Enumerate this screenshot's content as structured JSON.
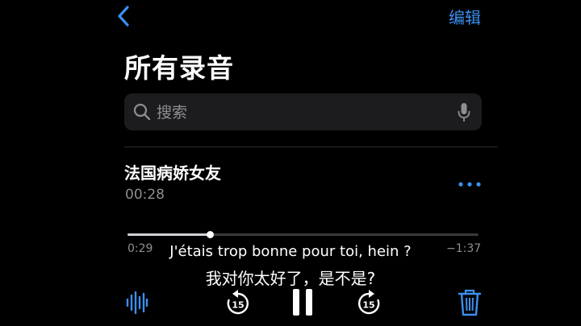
{
  "header": {
    "edit_label": "编辑"
  },
  "page": {
    "title": "所有录音"
  },
  "search": {
    "placeholder": "搜索"
  },
  "recording": {
    "title": "法国病娇女友",
    "duration": "00:28",
    "elapsed": "0:29",
    "remaining": "−1:37",
    "progress": 0.235
  },
  "subtitles": {
    "french": "J'étais trop bonne pour toi, hein ?",
    "chinese": "我对你太好了，是不是?"
  },
  "colors": {
    "accent": "#3b8ff0",
    "background": "#000000",
    "secondary_text": "#8e8e93"
  },
  "icons": {
    "back": "chevron-left-icon",
    "search": "search-icon",
    "mic": "microphone-icon",
    "more": "ellipsis-icon",
    "waveform": "waveform-icon",
    "skip_back": "skip-back-15-icon",
    "pause": "pause-icon",
    "skip_forward": "skip-forward-15-icon",
    "trash": "trash-icon"
  }
}
